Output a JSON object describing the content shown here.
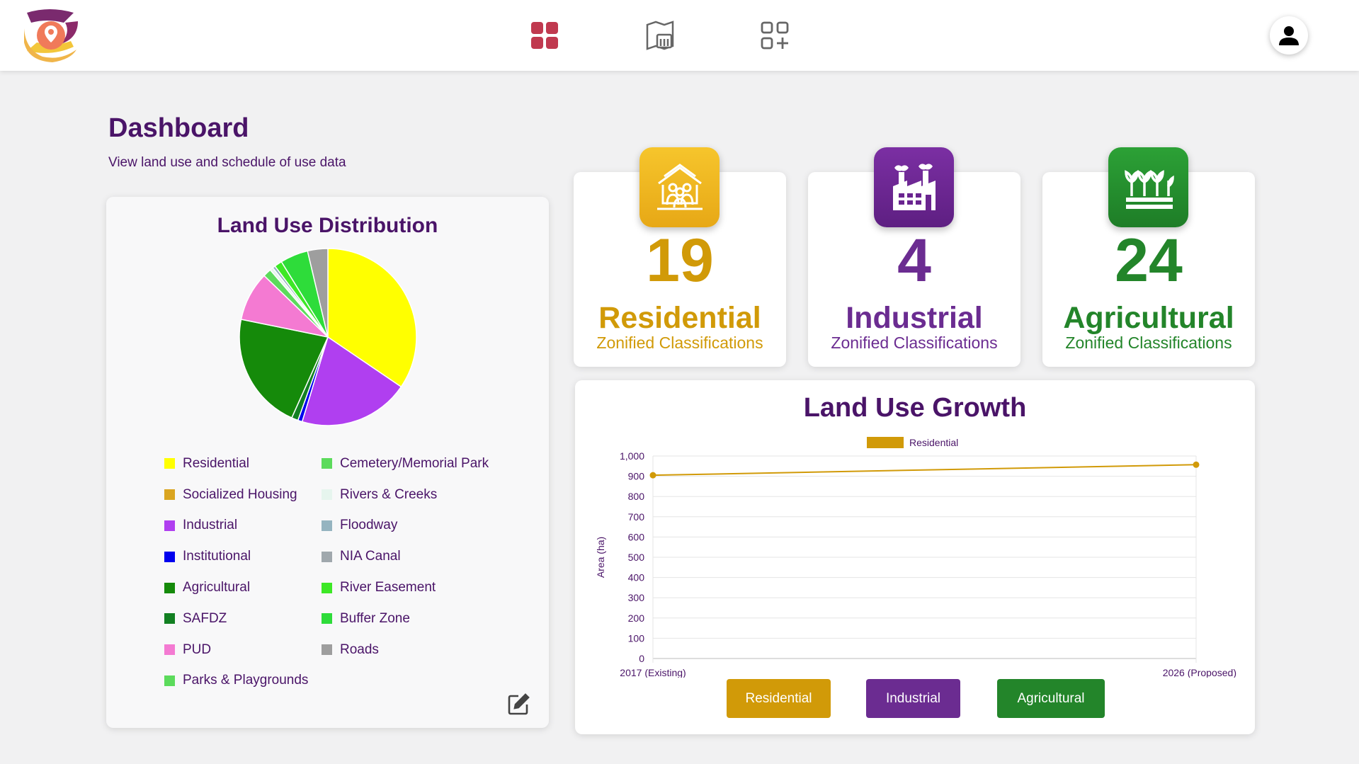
{
  "header": {
    "nav": [
      {
        "name": "dashboard-icon",
        "active": true
      },
      {
        "name": "map-layers-icon",
        "active": false
      },
      {
        "name": "add-widget-icon",
        "active": false
      }
    ],
    "avatar_icon": "user-icon"
  },
  "page": {
    "title": "Dashboard",
    "subtitle": "View land use and schedule of use data"
  },
  "pie": {
    "title": "Land Use Distribution",
    "edit_icon": "edit-icon",
    "legend": [
      {
        "label": "Residential",
        "color": "#ffff00"
      },
      {
        "label": "Cemetery/Memorial Park",
        "color": "#5cdb5c"
      },
      {
        "label": "Socialized Housing",
        "color": "#daa520"
      },
      {
        "label": "Rivers & Creeks",
        "color": "#e6f5ee"
      },
      {
        "label": "Industrial",
        "color": "#b03ff0"
      },
      {
        "label": "Floodway",
        "color": "#95b4c0"
      },
      {
        "label": "Institutional",
        "color": "#0000ee"
      },
      {
        "label": "NIA Canal",
        "color": "#a0a8ad"
      },
      {
        "label": "Agricultural",
        "color": "#158a0a"
      },
      {
        "label": "River Easement",
        "color": "#3de826"
      },
      {
        "label": "SAFDZ",
        "color": "#128022"
      },
      {
        "label": "Buffer Zone",
        "color": "#2edc3a"
      },
      {
        "label": "PUD",
        "color": "#f47ad2"
      },
      {
        "label": "Roads",
        "color": "#9e9e9e"
      },
      {
        "label": "Parks & Playgrounds",
        "color": "#5cdb5c"
      }
    ]
  },
  "chart_data": {
    "type": "pie",
    "title": "Land Use Distribution",
    "slices": [
      {
        "label": "Residential",
        "value": 34.5,
        "color": "#ffff00"
      },
      {
        "label": "Industrial",
        "value": 20.2,
        "color": "#b03ff0"
      },
      {
        "label": "Institutional",
        "value": 0.8,
        "color": "#0000ee"
      },
      {
        "label": "SAFDZ",
        "value": 1.2,
        "color": "#128022"
      },
      {
        "label": "Agricultural",
        "value": 21.5,
        "color": "#158a0a"
      },
      {
        "label": "PUD",
        "value": 9.0,
        "color": "#f47ad2"
      },
      {
        "label": "Parks & Playgrounds",
        "value": 1.5,
        "color": "#5cdb5c"
      },
      {
        "label": "Rivers & Creeks",
        "value": 0.6,
        "color": "#e6f5ee"
      },
      {
        "label": "Floodway",
        "value": 0.5,
        "color": "#95b4c0"
      },
      {
        "label": "River Easement",
        "value": 1.4,
        "color": "#3de826"
      },
      {
        "label": "Buffer Zone",
        "value": 5.1,
        "color": "#2edc3a"
      },
      {
        "label": "Roads",
        "value": 3.7,
        "color": "#9e9e9e"
      }
    ]
  },
  "stats": [
    {
      "number": "19",
      "label": "Residential",
      "sub": "Zonified Classifications",
      "color": "#d19a08",
      "badge": "#f2b820",
      "icon": "residential-community-icon"
    },
    {
      "number": "4",
      "label": "Industrial",
      "sub": "Zonified Classifications",
      "color": "#6b2c91",
      "badge": "#6a2590",
      "icon": "factory-icon"
    },
    {
      "number": "24",
      "label": "Agricultural",
      "sub": "Zonified Classifications",
      "color": "#23852a",
      "badge": "#238a2c",
      "icon": "crops-icon"
    }
  ],
  "growth": {
    "title": "Land Use Growth",
    "ylabel": "Area (ha)",
    "legend_label": "Residential",
    "line_color": "#d19a08",
    "yticks": [
      "0",
      "100",
      "200",
      "300",
      "400",
      "500",
      "600",
      "700",
      "800",
      "900",
      "1,000"
    ],
    "x": [
      "2017 (Existing)",
      "2026 (Proposed)"
    ],
    "values": [
      905,
      957
    ],
    "ylim": [
      0,
      1000
    ],
    "buttons": [
      {
        "label": "Residential",
        "color": "#d19a08"
      },
      {
        "label": "Industrial",
        "color": "#6b2c91"
      },
      {
        "label": "Agricultural",
        "color": "#23852a"
      }
    ]
  }
}
